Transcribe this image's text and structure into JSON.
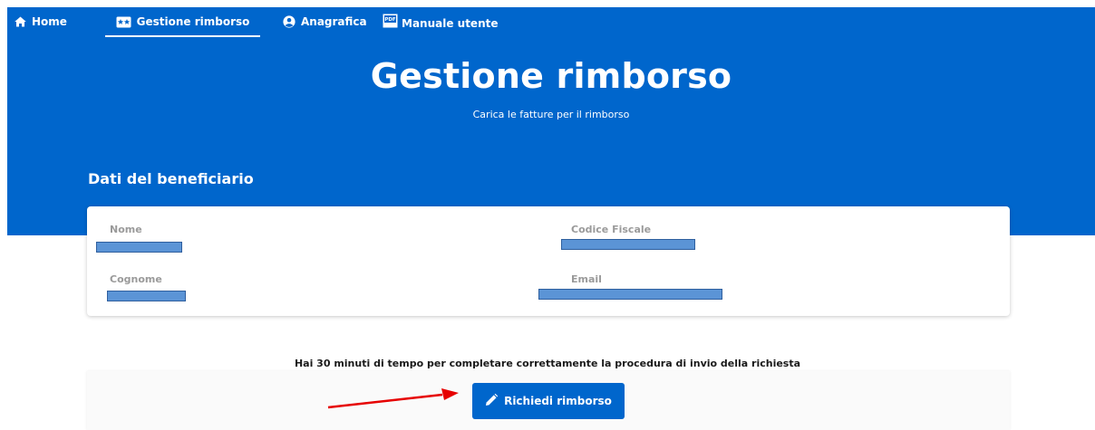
{
  "nav": {
    "items": [
      {
        "label": "Home",
        "icon": "home-icon"
      },
      {
        "label": "Gestione rimborso",
        "icon": "ticket-star-icon",
        "active": true
      },
      {
        "label": "Anagrafica",
        "icon": "user-circle-icon"
      },
      {
        "label": "Manuale utente",
        "icon": "pdf-icon"
      }
    ]
  },
  "hero": {
    "title": "Gestione rimborso",
    "subtitle": "Carica le fatture per il rimborso"
  },
  "beneficiary": {
    "section_title": "Dati del beneficiario",
    "fields": [
      {
        "label": "Nome"
      },
      {
        "label": "Codice Fiscale"
      },
      {
        "label": "Cognome"
      },
      {
        "label": "Email"
      }
    ]
  },
  "request": {
    "notice": "Hai 30 minuti di tempo per completare correttamente la procedura di invio della richiesta",
    "button_label": "Richiedi rimborso",
    "button_icon": "pencil-icon"
  },
  "colors": {
    "primary": "#0066cc",
    "annotation_arrow": "#e60000",
    "redaction": "#5b94d6"
  }
}
